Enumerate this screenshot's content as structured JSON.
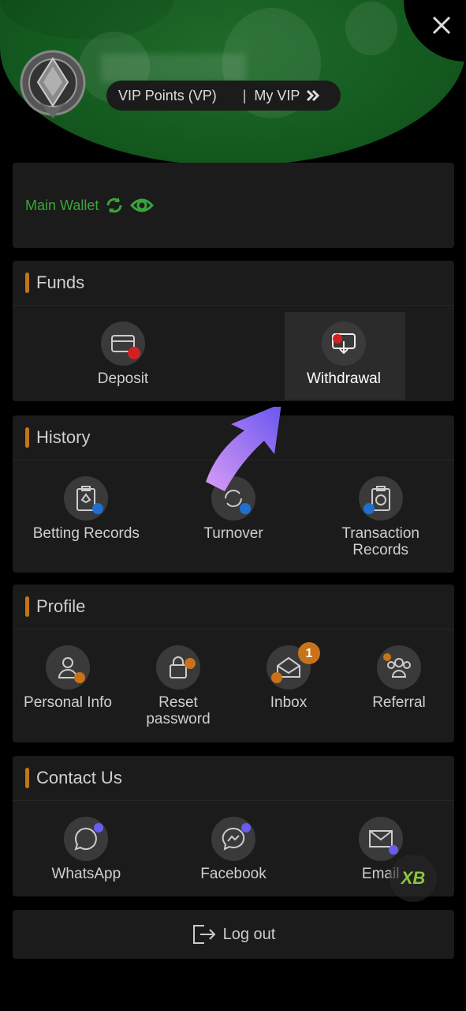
{
  "header": {
    "vip_points_label": "VIP Points (VP)",
    "separator": "|",
    "my_vip_label": "My VIP",
    "my_vip_icon": "double-chevron-right-icon"
  },
  "wallet": {
    "label": "Main Wallet",
    "refresh_icon": "refresh-icon",
    "eye_icon": "eye-icon",
    "color": "#3aa53a"
  },
  "funds": {
    "title": "Funds",
    "items": [
      {
        "label": "Deposit",
        "icon": "card-icon"
      },
      {
        "label": "Withdrawal",
        "icon": "card-withdraw-icon",
        "highlighted": true
      }
    ]
  },
  "history": {
    "title": "History",
    "items": [
      {
        "label": "Betting Records",
        "icon": "clipboard-spade-icon"
      },
      {
        "label": "Turnover",
        "icon": "turnover-icon"
      },
      {
        "label": "Transaction Records",
        "icon": "clipboard-dollar-icon"
      }
    ]
  },
  "profile": {
    "title": "Profile",
    "items": [
      {
        "label": "Personal Info",
        "icon": "user-icon"
      },
      {
        "label": "Reset password",
        "icon": "lock-icon"
      },
      {
        "label": "Inbox",
        "icon": "envelope-icon",
        "badge": "1"
      },
      {
        "label": "Referral",
        "icon": "group-icon"
      }
    ]
  },
  "contact": {
    "title": "Contact Us",
    "items": [
      {
        "label": "WhatsApp",
        "icon": "whatsapp-icon"
      },
      {
        "label": "Facebook",
        "icon": "messenger-icon"
      },
      {
        "label": "Email",
        "icon": "email-icon"
      }
    ]
  },
  "logout": {
    "label": "Log out",
    "icon": "logout-icon"
  },
  "colors": {
    "accent": "#c27518",
    "brand_green": "#145a1f",
    "card": "#1b1b1b"
  }
}
